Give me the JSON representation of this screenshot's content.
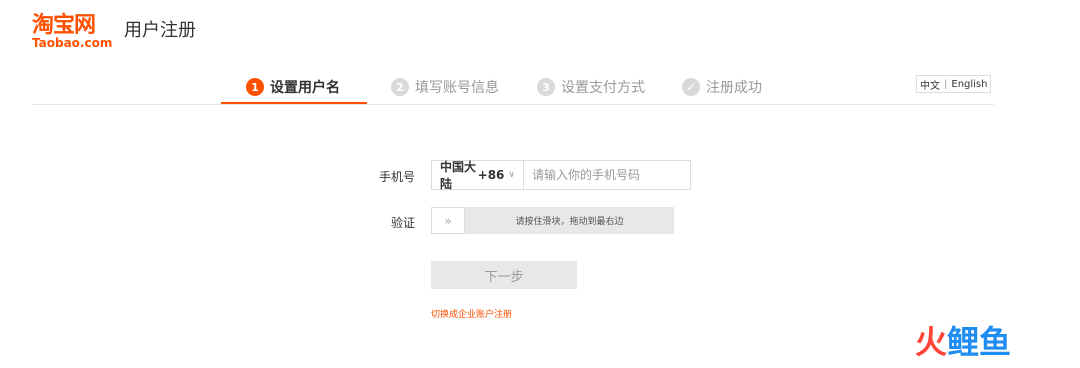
{
  "header": {
    "logo_cn": "淘宝网",
    "logo_en": "Taobao.com",
    "page_title": "用户注册"
  },
  "steps": [
    {
      "num": "1",
      "label": "设置用户名",
      "active": true
    },
    {
      "num": "2",
      "label": "填写账号信息",
      "active": false
    },
    {
      "num": "3",
      "label": "设置支付方式",
      "active": false
    },
    {
      "num": "✓",
      "label": "注册成功",
      "active": false
    }
  ],
  "lang": {
    "zh": "中文",
    "sep": "|",
    "en": "English"
  },
  "form": {
    "phone_label": "手机号",
    "country_name": "中国大陆",
    "country_code": "+86",
    "phone_placeholder": "请输入你的手机号码",
    "verify_label": "验证",
    "slider_handle": "»",
    "slider_text": "请按住滑块，拖动到最右边",
    "next_label": "下一步",
    "biz_link": "切换成企业账户注册"
  },
  "watermark": {
    "w1": "火",
    "w2": "鲤",
    "w3": "鱼"
  },
  "colors": {
    "accent": "#ff5000",
    "inactive": "#d9d9d9",
    "watermark_red": "#ff4338",
    "watermark_blue": "#1e8cf0"
  }
}
